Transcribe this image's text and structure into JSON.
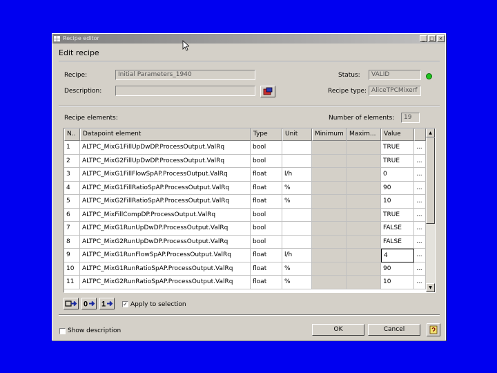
{
  "window": {
    "title": "Recipe editor",
    "heading": "Edit recipe",
    "controls": [
      "_",
      "□",
      "×"
    ]
  },
  "form": {
    "recipe_label": "Recipe:",
    "recipe_value": "Initial Parameters_1940",
    "description_label": "Description:",
    "description_value": "",
    "status_label": "Status:",
    "status_value": "VALID",
    "status_color": "#1ec41e",
    "recipe_type_label": "Recipe type:",
    "recipe_type_value": "AliceTPCMixerf"
  },
  "elements": {
    "label": "Recipe elements:",
    "count_label": "Number of elements:",
    "count_value": "19",
    "columns": [
      "N..",
      "Datapoint element",
      "Type",
      "Unit",
      "Minimum",
      "Maxim...",
      "Value",
      ""
    ],
    "rows": [
      [
        "1",
        "ALTPC_MixG1FillUpDwDP.ProcessOutput.ValRq",
        "bool",
        "",
        "",
        "",
        "TRUE",
        "..."
      ],
      [
        "2",
        "ALTPC_MixG2FillUpDwDP.ProcessOutput.ValRq",
        "bool",
        "",
        "",
        "",
        "TRUE",
        "..."
      ],
      [
        "3",
        "ALTPC_MixG1FillFlowSpAP.ProcessOutput.ValRq",
        "float",
        "l/h",
        "",
        "",
        "0",
        "..."
      ],
      [
        "4",
        "ALTPC_MixG1FillRatioSpAP.ProcessOutput.ValRq",
        "float",
        "%",
        "",
        "",
        "90",
        "..."
      ],
      [
        "5",
        "ALTPC_MixG2FillRatioSpAP.ProcessOutput.ValRq",
        "float",
        "%",
        "",
        "",
        "10",
        "..."
      ],
      [
        "6",
        "ALTPC_MixFillCompDP.ProcessOutput.ValRq",
        "bool",
        "",
        "",
        "",
        "TRUE",
        "..."
      ],
      [
        "7",
        "ALTPC_MixG1RunUpDwDP.ProcessOutput.ValRq",
        "bool",
        "",
        "",
        "",
        "FALSE",
        "..."
      ],
      [
        "8",
        "ALTPC_MixG2RunUpDwDP.ProcessOutput.ValRq",
        "bool",
        "",
        "",
        "",
        "FALSE",
        "..."
      ],
      [
        "9",
        "ALTPC_MixG1RunFlowSpAP.ProcessOutput.ValRq",
        "float",
        "l/h",
        "",
        "",
        "4",
        "..."
      ],
      [
        "10",
        "ALTPC_MixG1RunRatioSpAP.ProcessOutput.ValRq",
        "float",
        "%",
        "",
        "",
        "90",
        "..."
      ],
      [
        "11",
        "ALTPC_MixG2RunRatioSpAP.ProcessOutput.ValRq",
        "float",
        "%",
        "",
        "",
        "10",
        "..."
      ]
    ],
    "scroll_up": "▲",
    "scroll_down": "▼",
    "apply_label": "Apply to selection",
    "apply_checked": "✓",
    "tool_buttons": [
      "",
      "0",
      "1"
    ]
  },
  "footer": {
    "show_description_label": "Show description",
    "ok_label": "OK",
    "cancel_label": "Cancel"
  }
}
